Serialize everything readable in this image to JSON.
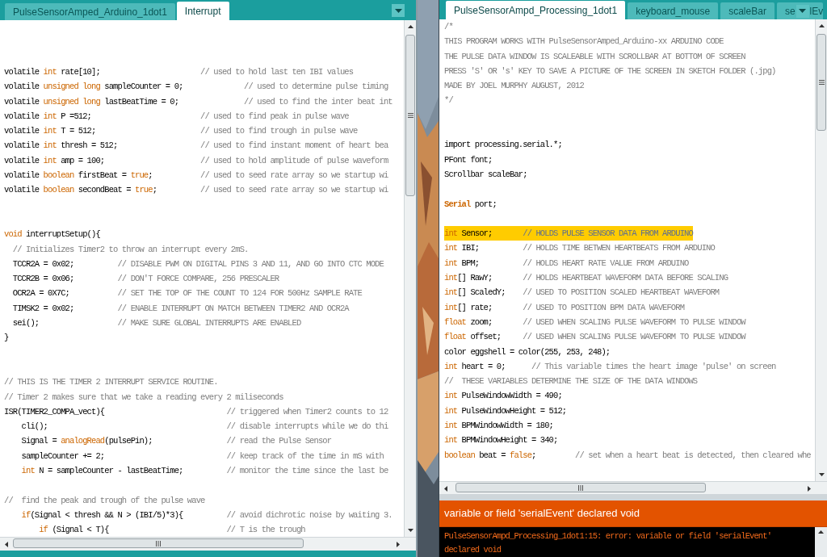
{
  "left_editor": {
    "tabs": [
      {
        "label": "PulseSensorAmped_Arduino_1dot1",
        "selected": false
      },
      {
        "label": "Interrupt",
        "selected": true
      }
    ],
    "lines": [
      {
        "kind": "code",
        "segments": [
          {
            "text": "volatile ",
            "kind": "plain"
          },
          {
            "text": "int",
            "kind": "keyword"
          },
          {
            "text": " rate[10];",
            "kind": "plain"
          },
          {
            "text": "                       // used to hold last ten IBI values",
            "kind": "comment"
          }
        ]
      },
      {
        "kind": "code",
        "segments": [
          {
            "text": "volatile ",
            "kind": "plain"
          },
          {
            "text": "unsigned long",
            "kind": "keyword"
          },
          {
            "text": " sampleCounter = 0;",
            "kind": "plain"
          },
          {
            "text": "              // used to determine pulse timing",
            "kind": "comment"
          }
        ]
      },
      {
        "kind": "code",
        "segments": [
          {
            "text": "volatile ",
            "kind": "plain"
          },
          {
            "text": "unsigned long",
            "kind": "keyword"
          },
          {
            "text": " lastBeatTime = 0;",
            "kind": "plain"
          },
          {
            "text": "               // used to find the inter beat int",
            "kind": "comment"
          }
        ]
      },
      {
        "kind": "code",
        "segments": [
          {
            "text": "volatile ",
            "kind": "plain"
          },
          {
            "text": "int",
            "kind": "keyword"
          },
          {
            "text": " P =512;",
            "kind": "plain"
          },
          {
            "text": "                         // used to find peak in pulse wave",
            "kind": "comment"
          }
        ]
      },
      {
        "kind": "code",
        "segments": [
          {
            "text": "volatile ",
            "kind": "plain"
          },
          {
            "text": "int",
            "kind": "keyword"
          },
          {
            "text": " T = 512;",
            "kind": "plain"
          },
          {
            "text": "                        // used to find trough in pulse wave",
            "kind": "comment"
          }
        ]
      },
      {
        "kind": "code",
        "segments": [
          {
            "text": "volatile ",
            "kind": "plain"
          },
          {
            "text": "int",
            "kind": "keyword"
          },
          {
            "text": " thresh = 512;",
            "kind": "plain"
          },
          {
            "text": "                   // used to find instant moment of heart bea",
            "kind": "comment"
          }
        ]
      },
      {
        "kind": "code",
        "segments": [
          {
            "text": "volatile ",
            "kind": "plain"
          },
          {
            "text": "int",
            "kind": "keyword"
          },
          {
            "text": " amp = 100;",
            "kind": "plain"
          },
          {
            "text": "                      // used to hold amplitude of pulse waveform",
            "kind": "comment"
          }
        ]
      },
      {
        "kind": "code",
        "segments": [
          {
            "text": "volatile ",
            "kind": "plain"
          },
          {
            "text": "boolean",
            "kind": "keyword"
          },
          {
            "text": " firstBeat = ",
            "kind": "plain"
          },
          {
            "text": "true",
            "kind": "keyword"
          },
          {
            "text": ";",
            "kind": "plain"
          },
          {
            "text": "           // used to seed rate array so we startup wi",
            "kind": "comment"
          }
        ]
      },
      {
        "kind": "code",
        "segments": [
          {
            "text": "volatile ",
            "kind": "plain"
          },
          {
            "text": "boolean",
            "kind": "keyword"
          },
          {
            "text": " secondBeat = ",
            "kind": "plain"
          },
          {
            "text": "true",
            "kind": "keyword"
          },
          {
            "text": ";",
            "kind": "plain"
          },
          {
            "text": "          // used to seed rate array so we startup wi",
            "kind": "comment"
          }
        ]
      },
      {
        "kind": "blank"
      },
      {
        "kind": "blank"
      },
      {
        "kind": "code",
        "segments": [
          {
            "text": "void",
            "kind": "keyword"
          },
          {
            "text": " interruptSetup(){",
            "kind": "plain"
          }
        ]
      },
      {
        "kind": "code",
        "segments": [
          {
            "text": "  // Initializes Timer2 to throw an interrupt every 2mS.",
            "kind": "comment"
          }
        ]
      },
      {
        "kind": "code",
        "segments": [
          {
            "text": "  TCCR2A = 0x02;",
            "kind": "plain"
          },
          {
            "text": "          // DISABLE PWM ON DIGITAL PINS 3 AND 11, AND GO INTO CTC MODE",
            "kind": "comment"
          }
        ]
      },
      {
        "kind": "code",
        "segments": [
          {
            "text": "  TCCR2B = 0x06;",
            "kind": "plain"
          },
          {
            "text": "          // DON'T FORCE COMPARE, 256 PRESCALER",
            "kind": "comment"
          }
        ]
      },
      {
        "kind": "code",
        "segments": [
          {
            "text": "  OCR2A = 0X7C;",
            "kind": "plain"
          },
          {
            "text": "           // SET THE TOP OF THE COUNT TO 124 FOR 500Hz SAMPLE RATE",
            "kind": "comment"
          }
        ]
      },
      {
        "kind": "code",
        "segments": [
          {
            "text": "  TIMSK2 = 0x02;",
            "kind": "plain"
          },
          {
            "text": "          // ENABLE INTERRUPT ON MATCH BETWEEN TIMER2 AND OCR2A",
            "kind": "comment"
          }
        ]
      },
      {
        "kind": "code",
        "segments": [
          {
            "text": "  sei();",
            "kind": "plain"
          },
          {
            "text": "                  // MAKE SURE GLOBAL INTERRUPTS ARE ENABLED",
            "kind": "comment"
          }
        ]
      },
      {
        "kind": "code",
        "segments": [
          {
            "text": "}",
            "kind": "plain"
          }
        ]
      },
      {
        "kind": "blank"
      },
      {
        "kind": "blank"
      },
      {
        "kind": "code",
        "segments": [
          {
            "text": "// THIS IS THE TIMER 2 INTERRUPT SERVICE ROUTINE.",
            "kind": "comment"
          }
        ]
      },
      {
        "kind": "code",
        "segments": [
          {
            "text": "// Timer 2 makes sure that we take a reading every 2 miliseconds",
            "kind": "comment"
          }
        ]
      },
      {
        "kind": "code",
        "segments": [
          {
            "text": "ISR(TIMER2_COMPA_vect){",
            "kind": "plain"
          },
          {
            "text": "                            // triggered when Timer2 counts to 12",
            "kind": "comment"
          }
        ]
      },
      {
        "kind": "code",
        "segments": [
          {
            "text": "    cli();",
            "kind": "plain"
          },
          {
            "text": "                                         // disable interrupts while we do thi",
            "kind": "comment"
          }
        ]
      },
      {
        "kind": "code",
        "segments": [
          {
            "text": "    Signal = ",
            "kind": "plain"
          },
          {
            "text": "analogRead",
            "kind": "keyword"
          },
          {
            "text": "(pulsePin);",
            "kind": "plain"
          },
          {
            "text": "                 // read the Pulse Sensor",
            "kind": "comment"
          }
        ]
      },
      {
        "kind": "code",
        "segments": [
          {
            "text": "    sampleCounter += 2;",
            "kind": "plain"
          },
          {
            "text": "                            // keep track of the time in mS with",
            "kind": "comment"
          }
        ]
      },
      {
        "kind": "code",
        "segments": [
          {
            "text": "    int",
            "kind": "keyword"
          },
          {
            "text": " N = sampleCounter - lastBeatTime;",
            "kind": "plain"
          },
          {
            "text": "          // monitor the time since the last be",
            "kind": "comment"
          }
        ]
      },
      {
        "kind": "blank"
      },
      {
        "kind": "code",
        "segments": [
          {
            "text": "//  find the peak and trough of the pulse wave",
            "kind": "comment"
          }
        ]
      },
      {
        "kind": "code",
        "segments": [
          {
            "text": "    if",
            "kind": "keyword"
          },
          {
            "text": "(Signal < thresh && N > (IBI/5)*3){",
            "kind": "plain"
          },
          {
            "text": "          // avoid dichrotic noise by waiting 3.",
            "kind": "comment"
          }
        ]
      },
      {
        "kind": "code",
        "segments": [
          {
            "text": "        if",
            "kind": "keyword"
          },
          {
            "text": " (Signal < T){",
            "kind": "plain"
          },
          {
            "text": "                           // T is the trough",
            "kind": "comment"
          }
        ]
      }
    ]
  },
  "right_editor": {
    "tabs": [
      {
        "label": "PulseSensorAmpd_Processing_1dot1",
        "selected": true
      },
      {
        "label": "keyboard_mouse",
        "selected": false
      },
      {
        "label": "scaleBar",
        "selected": false
      },
      {
        "label": "se",
        "label_after_menu": "lEv",
        "selected": false
      }
    ],
    "lines": [
      {
        "kind": "code",
        "segments": [
          {
            "text": "/*",
            "kind": "comment"
          }
        ]
      },
      {
        "kind": "code",
        "segments": [
          {
            "text": "THIS PROGRAM WORKS WITH PulseSensorAmped_Arduino-xx ARDUINO CODE",
            "kind": "comment"
          }
        ]
      },
      {
        "kind": "code",
        "segments": [
          {
            "text": "THE PULSE DATA WINDOW IS SCALEABLE WITH SCROLLBAR AT BOTTOM OF SCREEN",
            "kind": "comment"
          }
        ]
      },
      {
        "kind": "code",
        "segments": [
          {
            "text": "PRESS 'S' OR 's' KEY TO SAVE A PICTURE OF THE SCREEN IN SKETCH FOLDER (.jpg)",
            "kind": "comment"
          }
        ]
      },
      {
        "kind": "code",
        "segments": [
          {
            "text": "MADE BY JOEL MURPHY AUGUST, 2012",
            "kind": "comment"
          }
        ]
      },
      {
        "kind": "code",
        "segments": [
          {
            "text": "*/",
            "kind": "comment"
          }
        ]
      },
      {
        "kind": "blank"
      },
      {
        "kind": "blank"
      },
      {
        "kind": "code",
        "segments": [
          {
            "text": "import processing.serial.*;",
            "kind": "plain"
          }
        ]
      },
      {
        "kind": "code",
        "segments": [
          {
            "text": "PFont font;",
            "kind": "plain"
          }
        ]
      },
      {
        "kind": "code",
        "segments": [
          {
            "text": "Scrollbar scaleBar;",
            "kind": "plain"
          }
        ]
      },
      {
        "kind": "blank"
      },
      {
        "kind": "code",
        "segments": [
          {
            "text": "Serial",
            "kind": "class"
          },
          {
            "text": " port;",
            "kind": "plain"
          }
        ]
      },
      {
        "kind": "blank"
      },
      {
        "kind": "highlighted",
        "segments": [
          {
            "text": "int",
            "kind": "keyword"
          },
          {
            "text": " Sensor;",
            "kind": "plain"
          },
          {
            "text": "       // HOLDS PULSE SENSOR DATA FROM ARDUINO",
            "kind": "comment"
          }
        ]
      },
      {
        "kind": "code",
        "segments": [
          {
            "text": "int",
            "kind": "keyword"
          },
          {
            "text": " IBI;",
            "kind": "plain"
          },
          {
            "text": "          // HOLDS TIME BETWEN HEARTBEATS FROM ARDUINO",
            "kind": "comment"
          }
        ]
      },
      {
        "kind": "code",
        "segments": [
          {
            "text": "int",
            "kind": "keyword"
          },
          {
            "text": " BPM;",
            "kind": "plain"
          },
          {
            "text": "          // HOLDS HEART RATE VALUE FROM ARDUINO",
            "kind": "comment"
          }
        ]
      },
      {
        "kind": "code",
        "segments": [
          {
            "text": "int",
            "kind": "keyword"
          },
          {
            "text": "[] RawY;",
            "kind": "plain"
          },
          {
            "text": "       // HOLDS HEARTBEAT WAVEFORM DATA BEFORE SCALING",
            "kind": "comment"
          }
        ]
      },
      {
        "kind": "code",
        "segments": [
          {
            "text": "int",
            "kind": "keyword"
          },
          {
            "text": "[] ScaledY;",
            "kind": "plain"
          },
          {
            "text": "    // USED TO POSITION SCALED HEARTBEAT WAVEFORM",
            "kind": "comment"
          }
        ]
      },
      {
        "kind": "code",
        "segments": [
          {
            "text": "int",
            "kind": "keyword"
          },
          {
            "text": "[] rate;",
            "kind": "plain"
          },
          {
            "text": "       // USED TO POSITION BPM DATA WAVEFORM",
            "kind": "comment"
          }
        ]
      },
      {
        "kind": "code",
        "segments": [
          {
            "text": "float",
            "kind": "keyword"
          },
          {
            "text": " zoom;",
            "kind": "plain"
          },
          {
            "text": "       // USED WHEN SCALING PULSE WAVEFORM TO PULSE WINDOW",
            "kind": "comment"
          }
        ]
      },
      {
        "kind": "code",
        "segments": [
          {
            "text": "float",
            "kind": "keyword"
          },
          {
            "text": " offset;",
            "kind": "plain"
          },
          {
            "text": "     // USED WHEN SCALING PULSE WAVEFORM TO PULSE WINDOW",
            "kind": "comment"
          }
        ]
      },
      {
        "kind": "code",
        "segments": [
          {
            "text": "color eggshell = color(255, 253, 248);",
            "kind": "plain"
          }
        ]
      },
      {
        "kind": "code",
        "segments": [
          {
            "text": "int",
            "kind": "keyword"
          },
          {
            "text": " heart = 0;",
            "kind": "plain"
          },
          {
            "text": "      // This variable times the heart image 'pulse' on screen",
            "kind": "comment"
          }
        ]
      },
      {
        "kind": "code",
        "segments": [
          {
            "text": "//  THESE VARIABLES DETERMINE THE SIZE OF THE DATA WINDOWS",
            "kind": "comment"
          }
        ]
      },
      {
        "kind": "code",
        "segments": [
          {
            "text": "int",
            "kind": "keyword"
          },
          {
            "text": " PulseWindowWidth = 490;",
            "kind": "plain"
          }
        ]
      },
      {
        "kind": "code",
        "segments": [
          {
            "text": "int",
            "kind": "keyword"
          },
          {
            "text": " PulseWindowHeight = 512;",
            "kind": "plain"
          }
        ]
      },
      {
        "kind": "code",
        "segments": [
          {
            "text": "int",
            "kind": "keyword"
          },
          {
            "text": " BPMWindowWidth = 180;",
            "kind": "plain"
          }
        ]
      },
      {
        "kind": "code",
        "segments": [
          {
            "text": "int",
            "kind": "keyword"
          },
          {
            "text": " BPMWindowHeight = 340;",
            "kind": "plain"
          }
        ]
      },
      {
        "kind": "code",
        "segments": [
          {
            "text": "boolean",
            "kind": "keyword"
          },
          {
            "text": " beat = ",
            "kind": "plain"
          },
          {
            "text": "false",
            "kind": "keyword"
          },
          {
            "text": ";",
            "kind": "plain"
          },
          {
            "text": "         // set when a heart beat is detected, then cleared whe",
            "kind": "comment"
          }
        ]
      }
    ],
    "message": "variable or field 'serialEvent' declared void",
    "console": "PulseSensorAmpd_Processing_1dot1:15: error: variable or field 'serialEvent' declared void"
  }
}
